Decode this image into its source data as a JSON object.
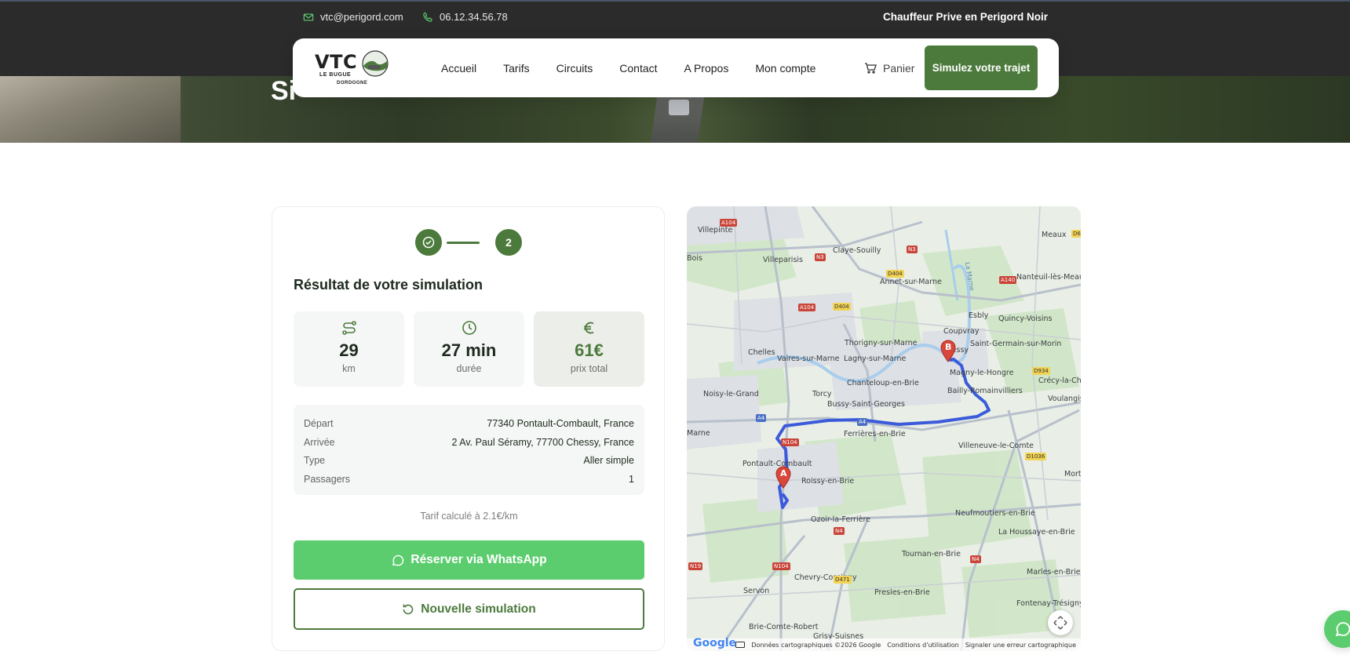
{
  "topbar": {
    "email": "vtc@perigord.com",
    "phone": "06.12.34.56.78",
    "tagline": "Chauffeur Prive en Perigord Noir"
  },
  "hero": {
    "title": "Si"
  },
  "logo": {
    "main": "VTC",
    "line1": "LE BUGUE",
    "line2": "DORDOGNE"
  },
  "nav": {
    "items": [
      "Accueil",
      "Tarifs",
      "Circuits",
      "Contact",
      "A Propos",
      "Mon compte"
    ],
    "cart_label": "Panier",
    "cta_label": "Simulez votre trajet"
  },
  "simulation": {
    "step_current": "2",
    "title": "Résultat de votre simulation",
    "stats": [
      {
        "icon": "route-icon",
        "value": "29",
        "unit": "km"
      },
      {
        "icon": "clock-icon",
        "value": "27 min",
        "unit": "durée"
      },
      {
        "icon": "euro-icon",
        "value": "61€",
        "unit": "prix total"
      }
    ],
    "details": [
      {
        "key": "Départ",
        "value": "77340 Pontault-Combault, France"
      },
      {
        "key": "Arrivée",
        "value": "2 Av. Paul Séramy, 77700 Chessy, France"
      },
      {
        "key": "Type",
        "value": "Aller simple"
      },
      {
        "key": "Passagers",
        "value": "1"
      }
    ],
    "tarif_note": "Tarif calculé à 2.1€/km",
    "whatsapp_label": "Réserver via WhatsApp",
    "new_label": "Nouvelle simulation"
  },
  "map": {
    "places": [
      "Villepinte",
      "Claye-Souilly",
      "Meaux",
      "Villeparisis",
      "Annet-sur-Marne",
      "Nanteuil-lès-Meaux",
      "Bois",
      "Esbly",
      "Quincy-Voisins",
      "Coupvray",
      "Thorigny-sur-Marne",
      "Chessy",
      "Saint-Germain-sur-Morin",
      "Chelles",
      "Vaires-sur-Marne",
      "Lagny-sur-Marne",
      "Magny-le-Hongre",
      "Crécy-la-Chapelle",
      "Chanteloup-en-Brie",
      "Bailly-Romainvilliers",
      "Noisy-le-Grand",
      "Torcy",
      "Bussy-Saint-Georges",
      "Voulangis",
      "Marne",
      "Ferrières-en-Brie",
      "Villeneuve-le-Comte",
      "Pontault-Combault",
      "Roissy-en-Brie",
      "Ozoir-la-Ferrière",
      "Neufmoutiers-en-Brie",
      "La Houssaye-en-Brie",
      "Tournan-en-Brie",
      "Marles-en-Brie",
      "Chevry-Cossigny",
      "Presles-en-Brie",
      "Servon",
      "Fontenay-Trésigny",
      "Brie-Comte-Robert",
      "Grisy-Suisnes",
      "La Marne",
      "Mort"
    ],
    "roads": [
      "A104",
      "N3",
      "N3",
      "D404",
      "D404",
      "A104",
      "A140",
      "A4",
      "A4",
      "D934",
      "D1036",
      "N4",
      "N104",
      "N19",
      "N104",
      "D471",
      "N4",
      "D6"
    ],
    "attribution": "Données cartographiques ©2026 Google",
    "terms": "Conditions d'utilisation",
    "report": "Signaler une erreur cartographique",
    "google": "Google",
    "marker_a": "A",
    "marker_b": "B"
  },
  "colors": {
    "brand_green": "#4c7a3c",
    "whatsapp_green": "#5ccd6e",
    "route_blue": "#3b5bdb",
    "marker_red": "#d9463b"
  }
}
